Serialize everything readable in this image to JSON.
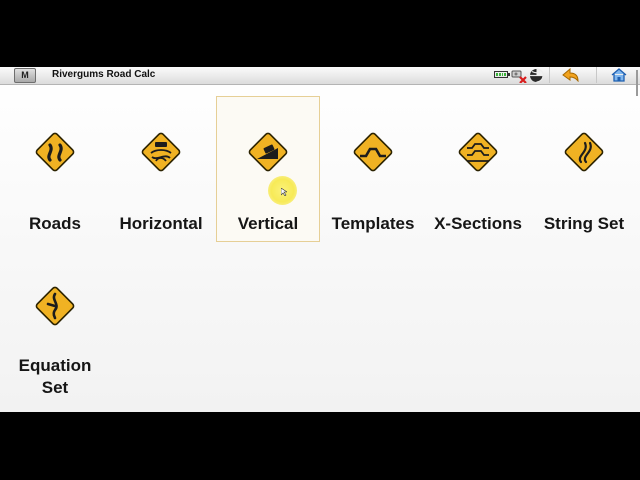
{
  "app": {
    "title": "Rivergums Road Calc",
    "menu_label": "M"
  },
  "status": {
    "battery_cells": 4
  },
  "tiles": [
    {
      "label": "Roads",
      "icon": "winding-road-icon"
    },
    {
      "label": "Horizontal",
      "icon": "car-on-curve-icon"
    },
    {
      "label": "Vertical",
      "icon": "steep-grade-icon",
      "selected": true
    },
    {
      "label": "Templates",
      "icon": "road-hump-icon"
    },
    {
      "label": "X-Sections",
      "icon": "road-cross-section-icon"
    },
    {
      "label": "String Set",
      "icon": "double-curve-icon"
    },
    {
      "label": "Equation Set",
      "icon": "road-junction-icon"
    }
  ],
  "colors": {
    "sign_fill": "#f0b223",
    "sign_border": "#2b2200",
    "selection_border": "#e6cf96",
    "cursor_highlight": "#f7ea57"
  }
}
